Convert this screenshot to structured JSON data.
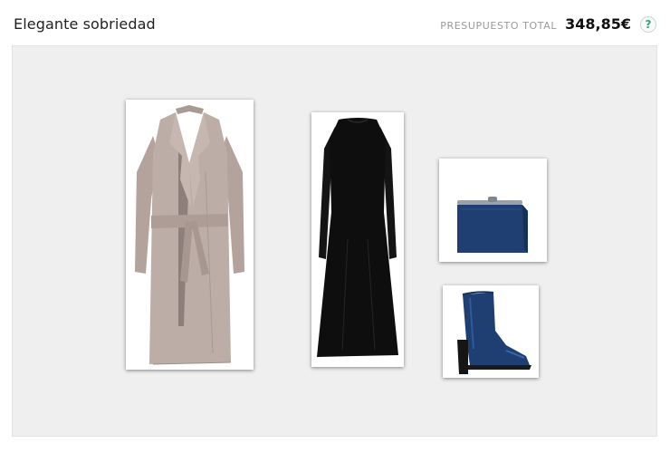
{
  "header": {
    "title": "Elegante sobriedad",
    "budget_label": "PRESUPUESTO TOTAL",
    "budget_value": "348,85€",
    "help_label": "?"
  },
  "items": [
    {
      "name": "coat",
      "icon": "long-beige-coat-photo"
    },
    {
      "name": "dress",
      "icon": "black-long-dress-photo"
    },
    {
      "name": "clutch",
      "icon": "navy-clutch-bag-photo"
    },
    {
      "name": "boot",
      "icon": "navy-ankle-boot-photo"
    }
  ],
  "colors": {
    "coat": "#b9aba4",
    "dress": "#111111",
    "navy": "#1f3f73",
    "canvas": "#efefef",
    "help_accent": "#38a07c"
  }
}
